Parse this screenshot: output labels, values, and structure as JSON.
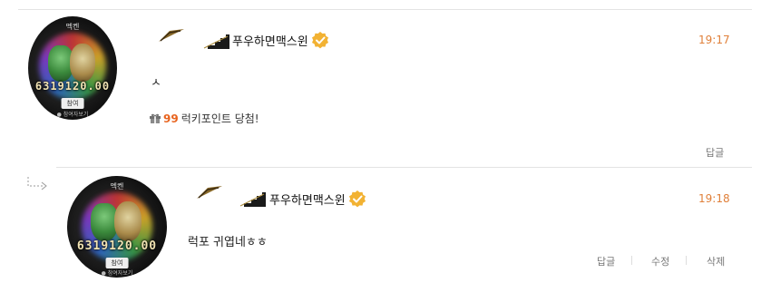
{
  "comments": [
    {
      "nickname": "푸우하면맥스윈",
      "time": "19:17",
      "text": "ㅅ",
      "lucky_points": "99",
      "lucky_text": "럭키포인트 당첨!",
      "actions": [
        "답글"
      ],
      "avatar": {
        "top": "멕켄",
        "amount": "6319120.00",
        "button": "참여",
        "sub": "● 참여자보기"
      }
    },
    {
      "nickname": "푸우하면맥스윈",
      "time": "19:18",
      "text": "럭포 귀엽네ㅎㅎ",
      "actions": [
        "답글",
        "수정",
        "삭제"
      ],
      "avatar": {
        "top": "멕켄",
        "amount": "6319120.00",
        "button": "참여",
        "sub": "● 참여자보기"
      }
    }
  ],
  "colors": {
    "time": "#e0803a",
    "lucky_number": "#e8641f",
    "divider": "#e3e3e3",
    "badge": "#f2b233"
  },
  "icons": {
    "verified": "verified-badge-icon",
    "gift": "gift-icon",
    "reply": "reply-arrow-icon",
    "deco": "chevron-decoration-icon"
  }
}
